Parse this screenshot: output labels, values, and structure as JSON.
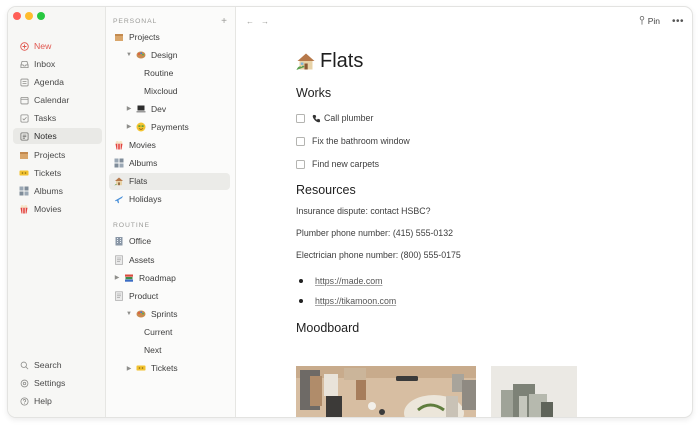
{
  "window": {
    "controls": {
      "close_color": "#ff5f57",
      "min_color": "#febc2e",
      "max_color": "#28c840"
    }
  },
  "sidebar": {
    "items": [
      {
        "label": "New",
        "icon": "plus-circle-icon"
      },
      {
        "label": "Inbox",
        "icon": "inbox-icon"
      },
      {
        "label": "Agenda",
        "icon": "agenda-icon"
      },
      {
        "label": "Calendar",
        "icon": "calendar-icon"
      },
      {
        "label": "Tasks",
        "icon": "checkbox-icon"
      },
      {
        "label": "Notes",
        "icon": "notes-icon",
        "active": true
      },
      {
        "label": "Projects",
        "icon": "package-icon"
      },
      {
        "label": "Tickets",
        "icon": "ticket-icon"
      },
      {
        "label": "Albums",
        "icon": "film-frames-icon"
      },
      {
        "label": "Movies",
        "icon": "popcorn-icon"
      }
    ],
    "bottom": [
      {
        "label": "Search",
        "icon": "search-icon"
      },
      {
        "label": "Settings",
        "icon": "gear-icon"
      },
      {
        "label": "Help",
        "icon": "help-icon"
      }
    ]
  },
  "tree": {
    "personal_header": "PERSONAL",
    "add_symbol": "+",
    "personal": [
      {
        "label": "Projects",
        "icon": "package-icon",
        "level": 0
      },
      {
        "label": "Design",
        "icon": "palette-icon",
        "level": 1,
        "toggle": "expanded"
      },
      {
        "label": "Routine",
        "level": 2
      },
      {
        "label": "Mixcloud",
        "level": 2
      },
      {
        "label": "Dev",
        "icon": "laptop-icon",
        "level": 1,
        "toggle": "collapsed"
      },
      {
        "label": "Payments",
        "icon": "money-face-icon",
        "level": 1,
        "toggle": "collapsed"
      },
      {
        "label": "Movies",
        "icon": "popcorn-icon",
        "level": 0
      },
      {
        "label": "Albums",
        "icon": "film-frames-icon",
        "level": 0
      },
      {
        "label": "Flats",
        "icon": "house-icon",
        "level": 0,
        "active": true
      },
      {
        "label": "Holidays",
        "icon": "airplane-icon",
        "level": 0
      }
    ],
    "routine_header": "ROUTINE",
    "routine": [
      {
        "label": "Office",
        "icon": "office-icon",
        "level": 0
      },
      {
        "label": "Assets",
        "icon": "page-icon",
        "level": 0
      },
      {
        "label": "Roadmap",
        "icon": "books-icon",
        "level": 0,
        "toggle": "collapsed"
      },
      {
        "label": "Product",
        "icon": "page-icon",
        "level": 0
      },
      {
        "label": "Sprints",
        "icon": "palette-icon",
        "level": 1,
        "toggle": "expanded"
      },
      {
        "label": "Current",
        "level": 2
      },
      {
        "label": "Next",
        "level": 2
      },
      {
        "label": "Tickets",
        "icon": "ticket-icon",
        "level": 1,
        "toggle": "collapsed"
      }
    ]
  },
  "topbar": {
    "back": "←",
    "forward": "→",
    "pin_label": "Pin",
    "more": "•••"
  },
  "doc": {
    "title": "Flats",
    "title_icon": "house-icon",
    "works_heading": "Works",
    "todos": [
      {
        "label": "Call plumber",
        "icon": "phone-icon"
      },
      {
        "label": "Fix the bathroom window"
      },
      {
        "label": "Find new carpets"
      }
    ],
    "resources_heading": "Resources",
    "paragraphs": [
      "Insurance dispute: contact HSBC?",
      "Plumber phone number: (415) 555-0132",
      "Electrician phone number: (800) 555-0175"
    ],
    "links": [
      "https://made.com",
      "https://tikamoon.com"
    ],
    "moodboard_heading": "Moodboard"
  }
}
